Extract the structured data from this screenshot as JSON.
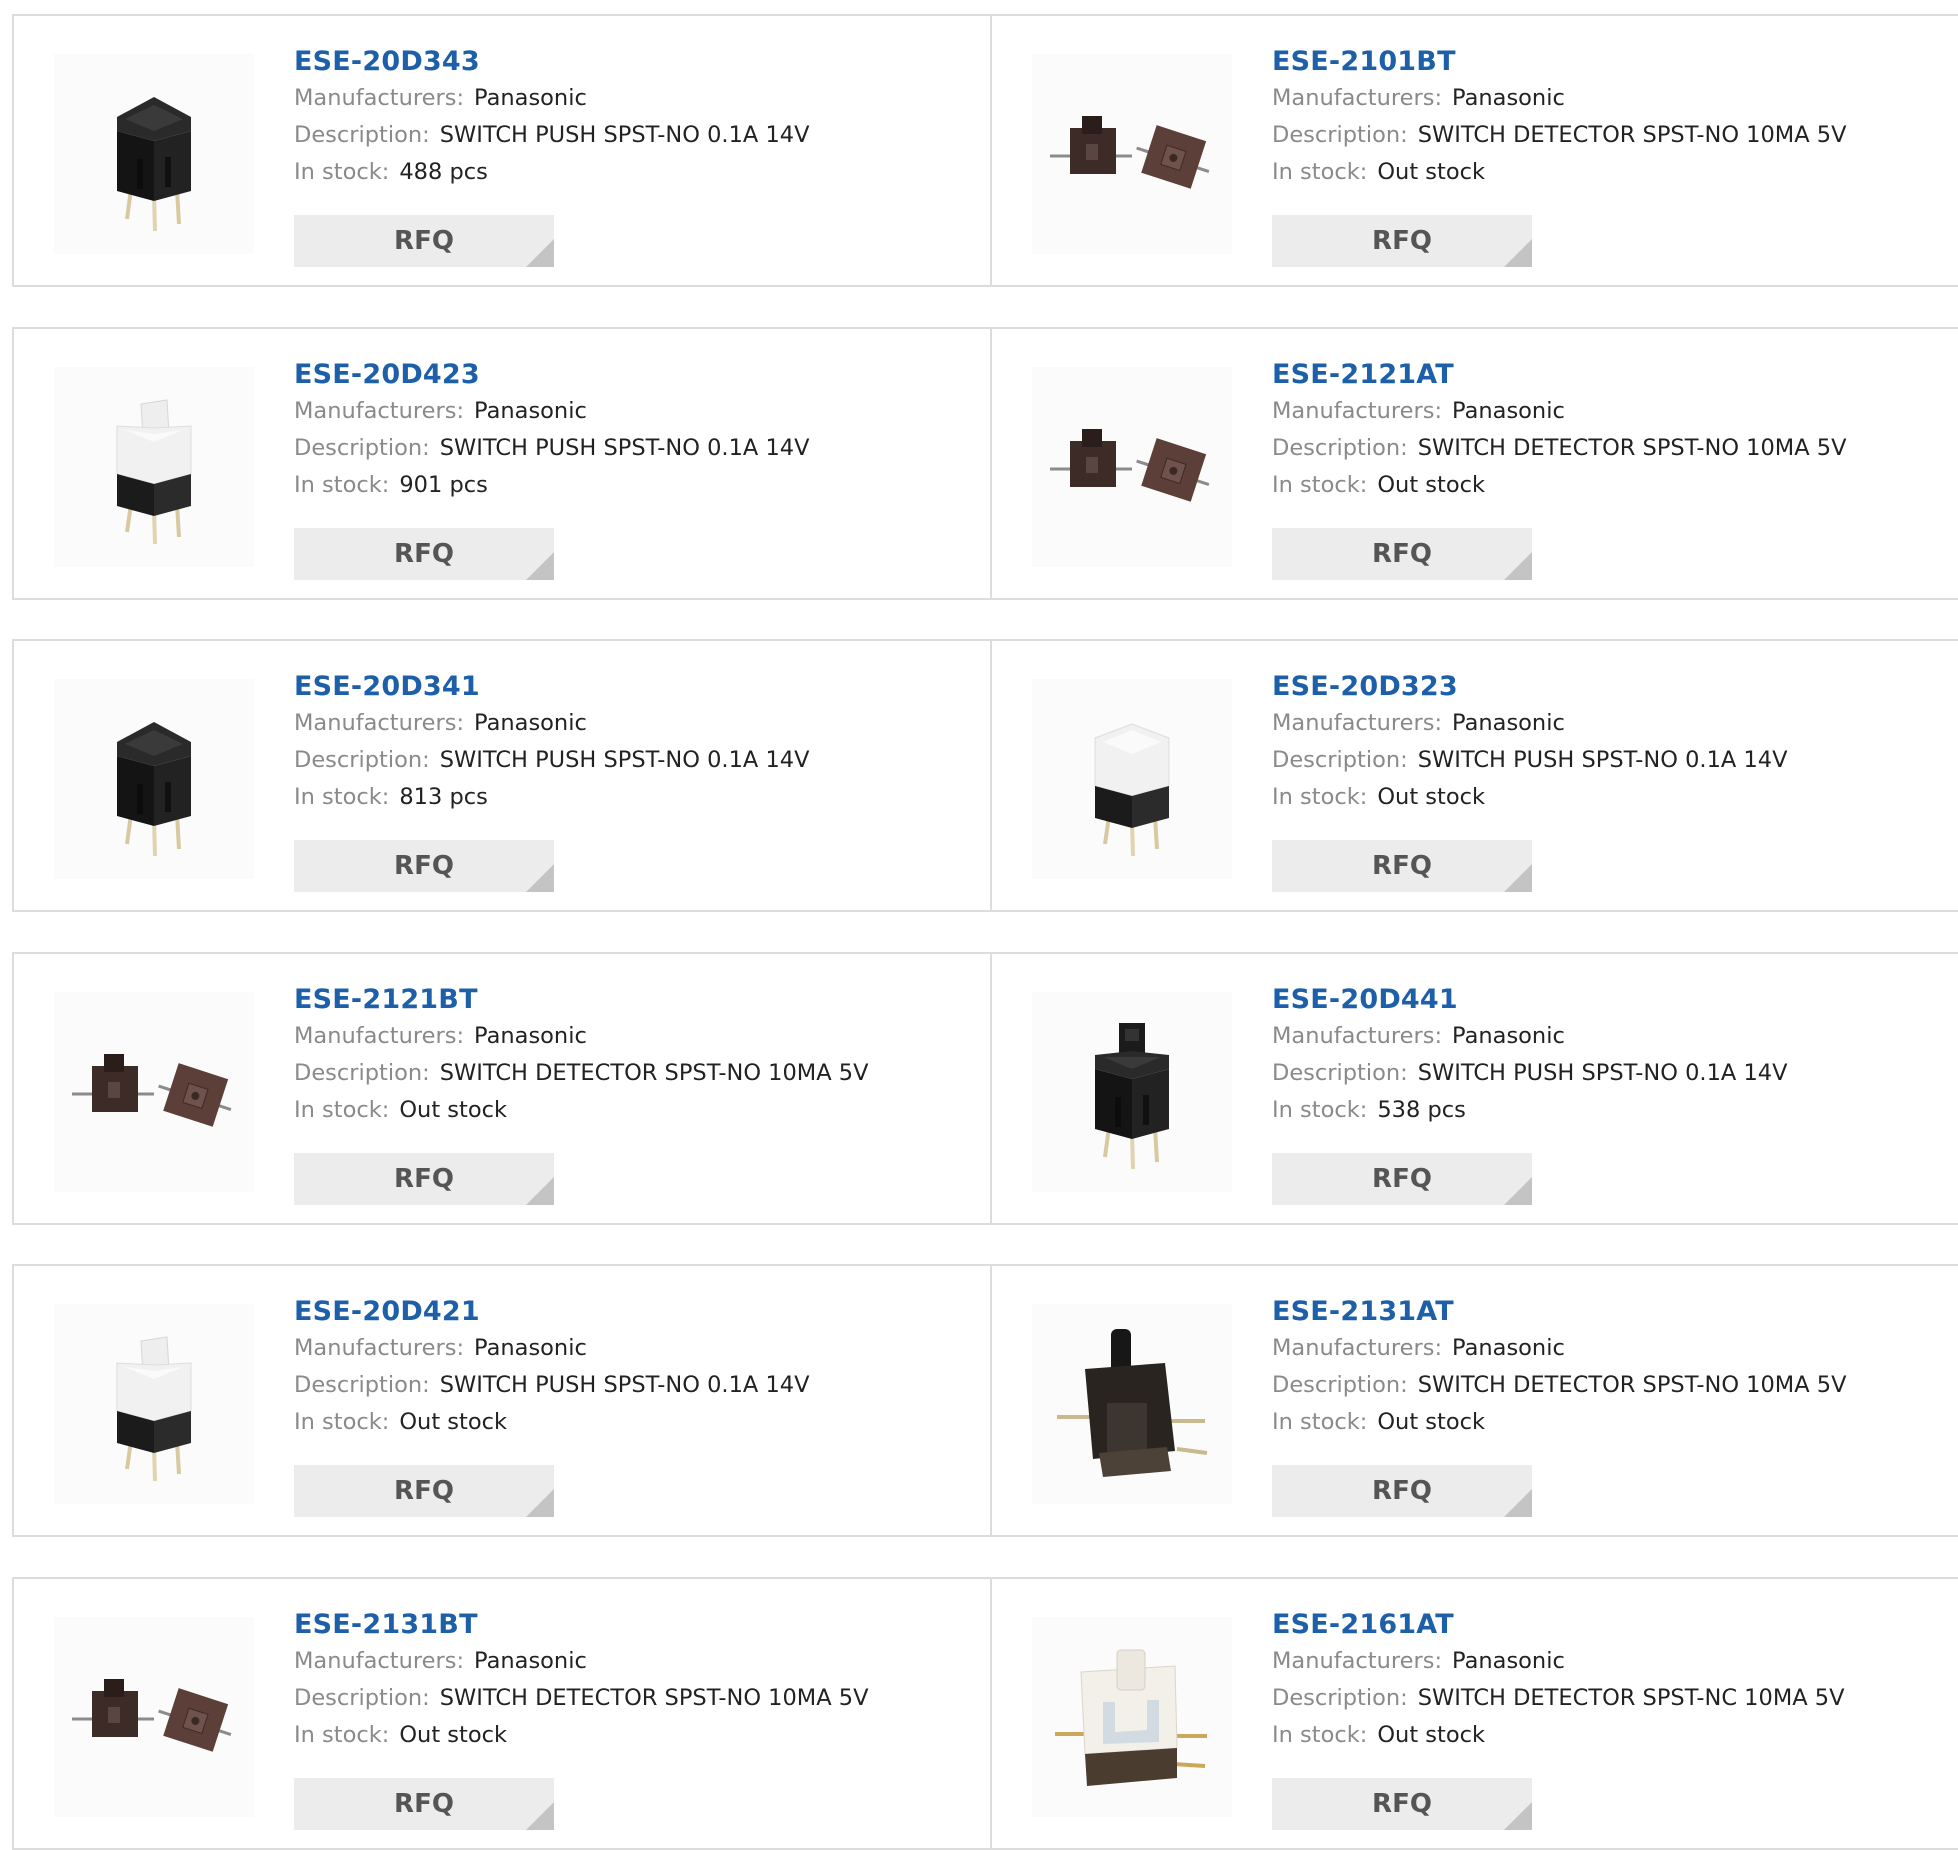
{
  "labels": {
    "manufacturers": "Manufacturers:",
    "description": "Description:",
    "in_stock": "In stock:",
    "rfq": "RFQ"
  },
  "colors": {
    "part_link": "#1d5fa8",
    "rfq_bg": "#ececec",
    "border": "#dcdcdc"
  },
  "products": [
    {
      "part": "ESE-20D343",
      "manufacturer": "Panasonic",
      "description": "SWITCH PUSH SPST-NO 0.1A 14V",
      "stock": "488 pcs",
      "image": "black-push-switch"
    },
    {
      "part": "ESE-2101BT",
      "manufacturer": "Panasonic",
      "description": "SWITCH DETECTOR SPST-NO 10MA 5V",
      "stock": "Out stock",
      "image": "brown-detector-pair"
    },
    {
      "part": "ESE-20D423",
      "manufacturer": "Panasonic",
      "description": "SWITCH PUSH SPST-NO 0.1A 14V",
      "stock": "901 pcs",
      "image": "white-push-switch-tall"
    },
    {
      "part": "ESE-2121AT",
      "manufacturer": "Panasonic",
      "description": "SWITCH DETECTOR SPST-NO 10MA 5V",
      "stock": "Out stock",
      "image": "brown-detector-pair"
    },
    {
      "part": "ESE-20D341",
      "manufacturer": "Panasonic",
      "description": "SWITCH PUSH SPST-NO 0.1A 14V",
      "stock": "813 pcs",
      "image": "black-push-switch"
    },
    {
      "part": "ESE-20D323",
      "manufacturer": "Panasonic",
      "description": "SWITCH PUSH SPST-NO 0.1A 14V",
      "stock": "Out stock",
      "image": "white-push-switch"
    },
    {
      "part": "ESE-2121BT",
      "manufacturer": "Panasonic",
      "description": "SWITCH DETECTOR SPST-NO 10MA 5V",
      "stock": "Out stock",
      "image": "brown-detector-pair"
    },
    {
      "part": "ESE-20D441",
      "manufacturer": "Panasonic",
      "description": "SWITCH PUSH SPST-NO 0.1A 14V",
      "stock": "538 pcs",
      "image": "black-push-switch-tall"
    },
    {
      "part": "ESE-20D421",
      "manufacturer": "Panasonic",
      "description": "SWITCH PUSH SPST-NO 0.1A 14V",
      "stock": "Out stock",
      "image": "white-push-switch-tall"
    },
    {
      "part": "ESE-2131AT",
      "manufacturer": "Panasonic",
      "description": "SWITCH DETECTOR SPST-NO 10MA 5V",
      "stock": "Out stock",
      "image": "black-detector-lever"
    },
    {
      "part": "ESE-2131BT",
      "manufacturer": "Panasonic",
      "description": "SWITCH DETECTOR SPST-NO 10MA 5V",
      "stock": "Out stock",
      "image": "brown-detector-pair"
    },
    {
      "part": "ESE-2161AT",
      "manufacturer": "Panasonic",
      "description": "SWITCH DETECTOR SPST-NC 10MA 5V",
      "stock": "Out stock",
      "image": "white-detector"
    }
  ]
}
